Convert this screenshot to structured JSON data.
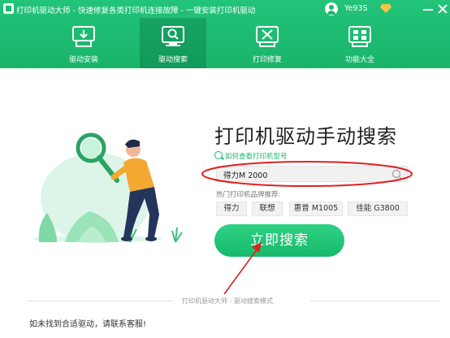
{
  "window": {
    "title": "打印机驱动大师 - 快速修复各类打印机连接故障 - 一键安装打印机驱动",
    "username": "Ye93S"
  },
  "nav": {
    "tabs": [
      {
        "label": "驱动安装",
        "icon": "printer-download-icon",
        "active": false
      },
      {
        "label": "驱动搜索",
        "icon": "monitor-search-icon",
        "active": true
      },
      {
        "label": "打印修复",
        "icon": "repair-tools-icon",
        "active": false
      },
      {
        "label": "功能大全",
        "icon": "feature-grid-icon",
        "active": false
      }
    ]
  },
  "main": {
    "title": "打印机驱动手动搜索",
    "help_link": "如何查看打印机型号",
    "search": {
      "value": "得力M 2000"
    },
    "brands_label": "热门打印机品牌推荐:",
    "brands": [
      "得力",
      "联想",
      "惠普 M1005",
      "佳能 G3800"
    ],
    "search_button": "立即搜索",
    "mode_label": "打印机驱动大师 - 驱动搜索模式",
    "footer_note": "如未找到合适驱动，请联系客服!"
  },
  "colors": {
    "brand_green": "#1cb86d",
    "annotation_red": "#e02020"
  }
}
